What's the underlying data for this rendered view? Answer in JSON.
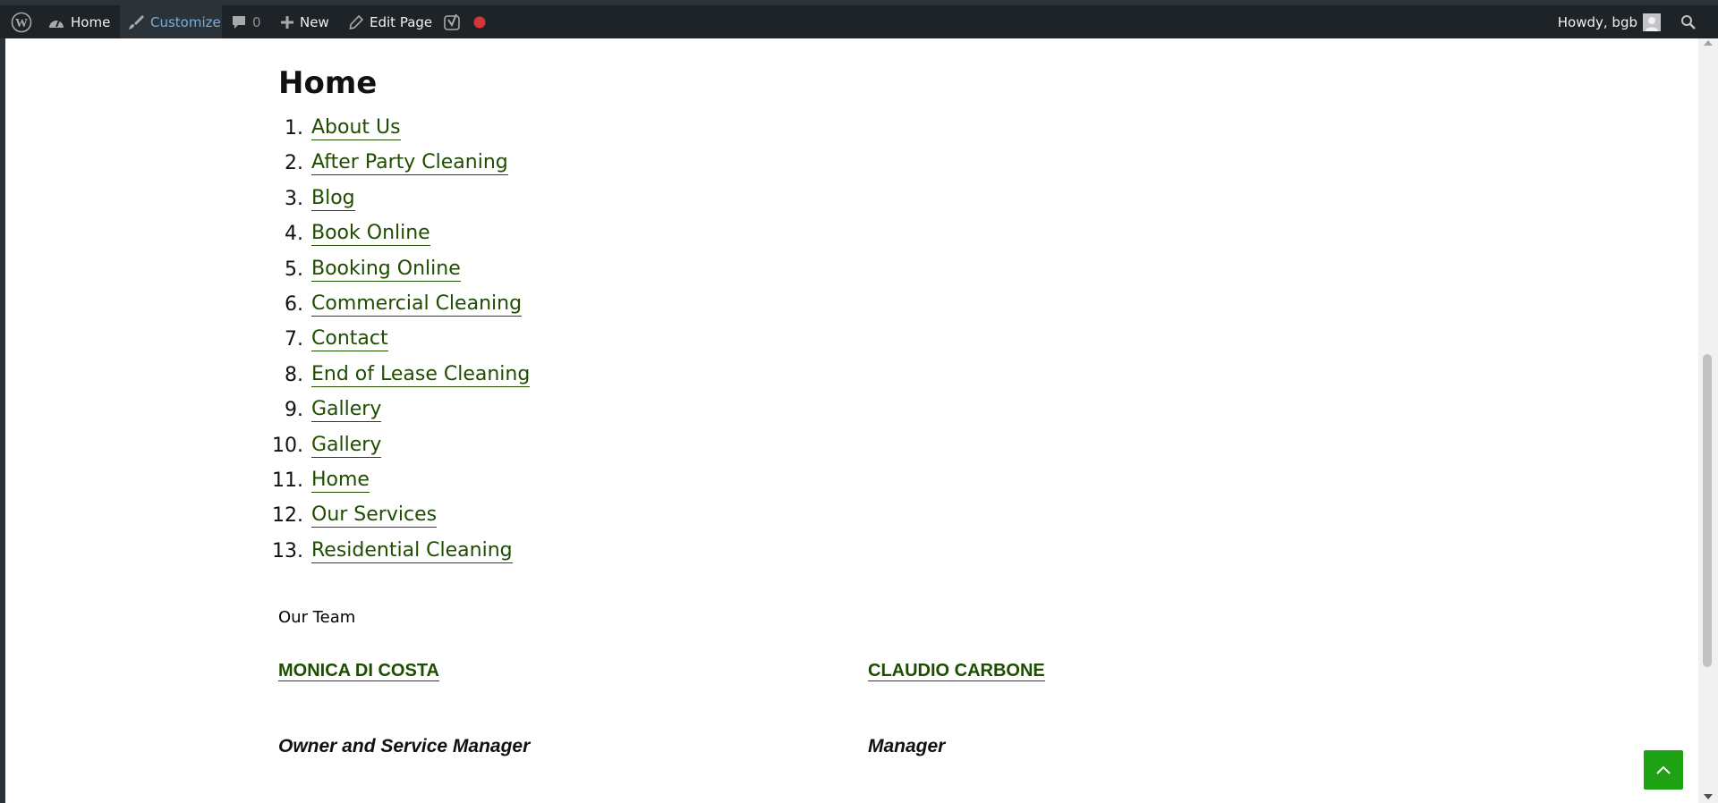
{
  "admin_bar": {
    "home_label": "Home",
    "customize_label": "Customize",
    "comments_count": "0",
    "new_label": "New",
    "edit_label": "Edit Page",
    "howdy": "Howdy, bgb"
  },
  "page": {
    "title": "Home",
    "links": [
      {
        "num": "1.",
        "label": "About Us"
      },
      {
        "num": "2.",
        "label": "After Party Cleaning"
      },
      {
        "num": "3.",
        "label": "Blog"
      },
      {
        "num": "4.",
        "label": "Book Online"
      },
      {
        "num": "5.",
        "label": "Booking Online"
      },
      {
        "num": "6.",
        "label": "Commercial Cleaning"
      },
      {
        "num": "7.",
        "label": "Contact"
      },
      {
        "num": "8.",
        "label": "End of Lease Cleaning"
      },
      {
        "num": "9.",
        "label": "Gallery"
      },
      {
        "num": "10.",
        "label": "Gallery"
      },
      {
        "num": "11.",
        "label": "Home"
      },
      {
        "num": "12.",
        "label": "Our Services"
      },
      {
        "num": "13.",
        "label": "Residential Cleaning"
      }
    ]
  },
  "team": {
    "heading": "Our Team",
    "members": [
      {
        "name": "MONICA DI COSTA",
        "role": "Owner and Service Manager"
      },
      {
        "name": "CLAUDIO CARBONE",
        "role": "Manager"
      }
    ]
  },
  "colors": {
    "admin_bar_bg": "#1d2327",
    "link_green": "#1e4d00",
    "accent_blue": "#72aee6",
    "back_to_top_green": "#1ea113",
    "record_dot": "#d63638"
  }
}
